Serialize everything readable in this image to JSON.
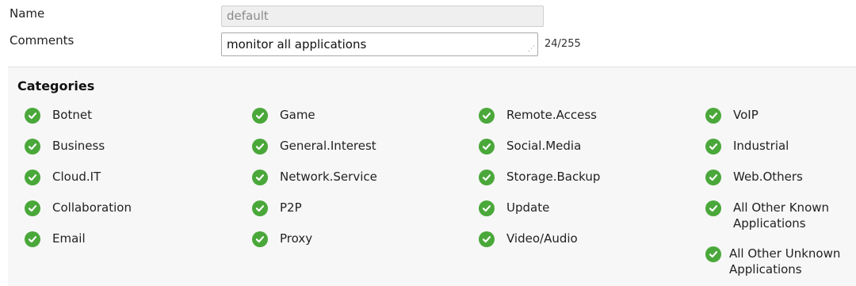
{
  "form": {
    "name_label": "Name",
    "name_value": "default",
    "comments_label": "Comments",
    "comments_value": "monitor all applications",
    "comments_count": "24/255"
  },
  "categories": {
    "heading": "Categories",
    "icon": "check-circle-icon",
    "check_color": "#4aa83a",
    "columns": [
      [
        "Botnet",
        "Business",
        "Cloud.IT",
        "Collaboration",
        "Email"
      ],
      [
        "Game",
        "General.Interest",
        "Network.Service",
        "P2P",
        "Proxy"
      ],
      [
        "Remote.Access",
        "Social.Media",
        "Storage.Backup",
        "Update",
        "Video/Audio"
      ],
      [
        "VoIP",
        "Industrial",
        "Web.Others",
        "All Other Known Applications",
        "All Other Unknown Applications"
      ]
    ]
  }
}
